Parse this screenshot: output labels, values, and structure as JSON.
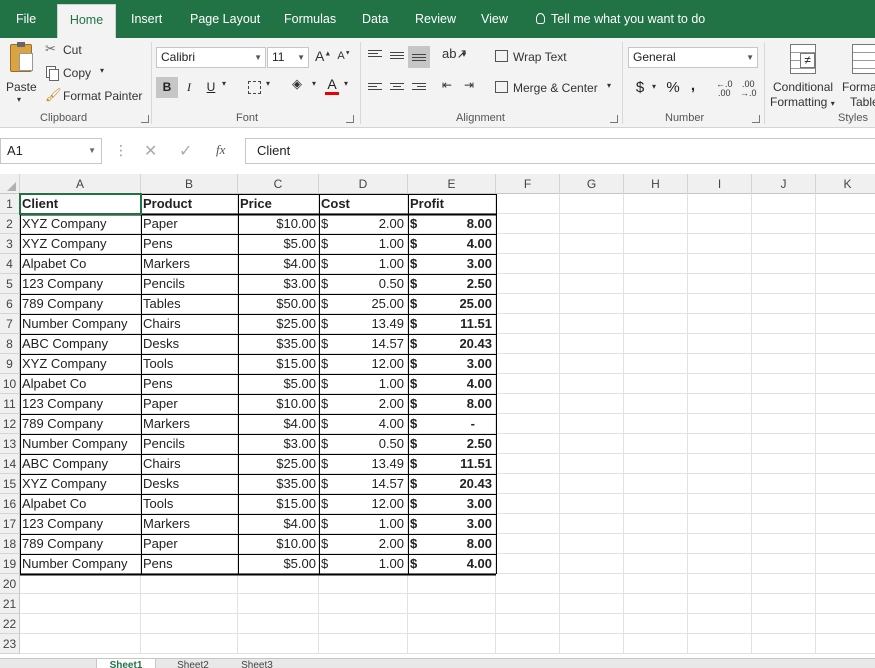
{
  "menu": {
    "tabs": [
      "File",
      "Home",
      "Insert",
      "Page Layout",
      "Formulas",
      "Data",
      "Review",
      "View"
    ],
    "active": "Home",
    "tell_me": "Tell me what you want to do"
  },
  "ribbon": {
    "clipboard": {
      "paste": "Paste",
      "cut": "Cut",
      "copy": "Copy",
      "format_painter": "Format Painter",
      "label": "Clipboard"
    },
    "font": {
      "name": "Calibri",
      "size": "11",
      "bold": "B",
      "italic": "I",
      "underline": "U",
      "label": "Font"
    },
    "alignment": {
      "wrap_text": "Wrap Text",
      "merge_center": "Merge & Center",
      "label": "Alignment"
    },
    "number": {
      "format": "General",
      "currency": "$",
      "percent": "%",
      "comma": ",",
      "label": "Number"
    },
    "styles": {
      "conditional_1": "Conditional",
      "conditional_2": "Formatting",
      "format_1": "Forma",
      "format_2": "Table",
      "label": "Styles"
    }
  },
  "formula_bar": {
    "name_box": "A1",
    "fx": "fx",
    "value": "Client"
  },
  "columns": [
    "A",
    "B",
    "C",
    "D",
    "E",
    "F",
    "G",
    "H",
    "I",
    "J",
    "K"
  ],
  "row_numbers": [
    "1",
    "2",
    "3",
    "4",
    "5",
    "6",
    "7",
    "8",
    "9",
    "10",
    "11",
    "12",
    "13",
    "14",
    "15",
    "16",
    "17",
    "18",
    "19",
    "20",
    "21",
    "22",
    "23"
  ],
  "table": {
    "headers": [
      "Client",
      "Product",
      "Price",
      "Cost",
      "Profit"
    ],
    "rows": [
      [
        "XYZ Company",
        "Paper",
        "$10.00",
        "2.00",
        "8.00"
      ],
      [
        "XYZ Company",
        "Pens",
        "$5.00",
        "1.00",
        "4.00"
      ],
      [
        "Alpabet Co",
        "Markers",
        "$4.00",
        "1.00",
        "3.00"
      ],
      [
        "123 Company",
        "Pencils",
        "$3.00",
        "0.50",
        "2.50"
      ],
      [
        "789 Company",
        "Tables",
        "$50.00",
        "25.00",
        "25.00"
      ],
      [
        "Number Company",
        "Chairs",
        "$25.00",
        "13.49",
        "11.51"
      ],
      [
        "ABC Company",
        "Desks",
        "$35.00",
        "14.57",
        "20.43"
      ],
      [
        "XYZ Company",
        "Tools",
        "$15.00",
        "12.00",
        "3.00"
      ],
      [
        "Alpabet Co",
        "Pens",
        "$5.00",
        "1.00",
        "4.00"
      ],
      [
        "123 Company",
        "Paper",
        "$10.00",
        "2.00",
        "8.00"
      ],
      [
        "789 Company",
        "Markers",
        "$4.00",
        "4.00",
        "-"
      ],
      [
        "Number Company",
        "Pencils",
        "$3.00",
        "0.50",
        "2.50"
      ],
      [
        "ABC Company",
        "Chairs",
        "$25.00",
        "13.49",
        "11.51"
      ],
      [
        "XYZ Company",
        "Desks",
        "$35.00",
        "14.57",
        "20.43"
      ],
      [
        "Alpabet Co",
        "Tools",
        "$15.00",
        "12.00",
        "3.00"
      ],
      [
        "123 Company",
        "Markers",
        "$4.00",
        "1.00",
        "3.00"
      ],
      [
        "789 Company",
        "Paper",
        "$10.00",
        "2.00",
        "8.00"
      ],
      [
        "Number Company",
        "Pens",
        "$5.00",
        "1.00",
        "4.00"
      ]
    ],
    "currency_symbol": "$"
  },
  "sheet_tabs": [
    "Sheet1",
    "Sheet2",
    "Sheet3"
  ],
  "colors": {
    "accent": "#217346",
    "ribbon_bg": "#f3f3f3",
    "header_bg": "#f0f0f0",
    "gridline": "#e1e1e1"
  }
}
